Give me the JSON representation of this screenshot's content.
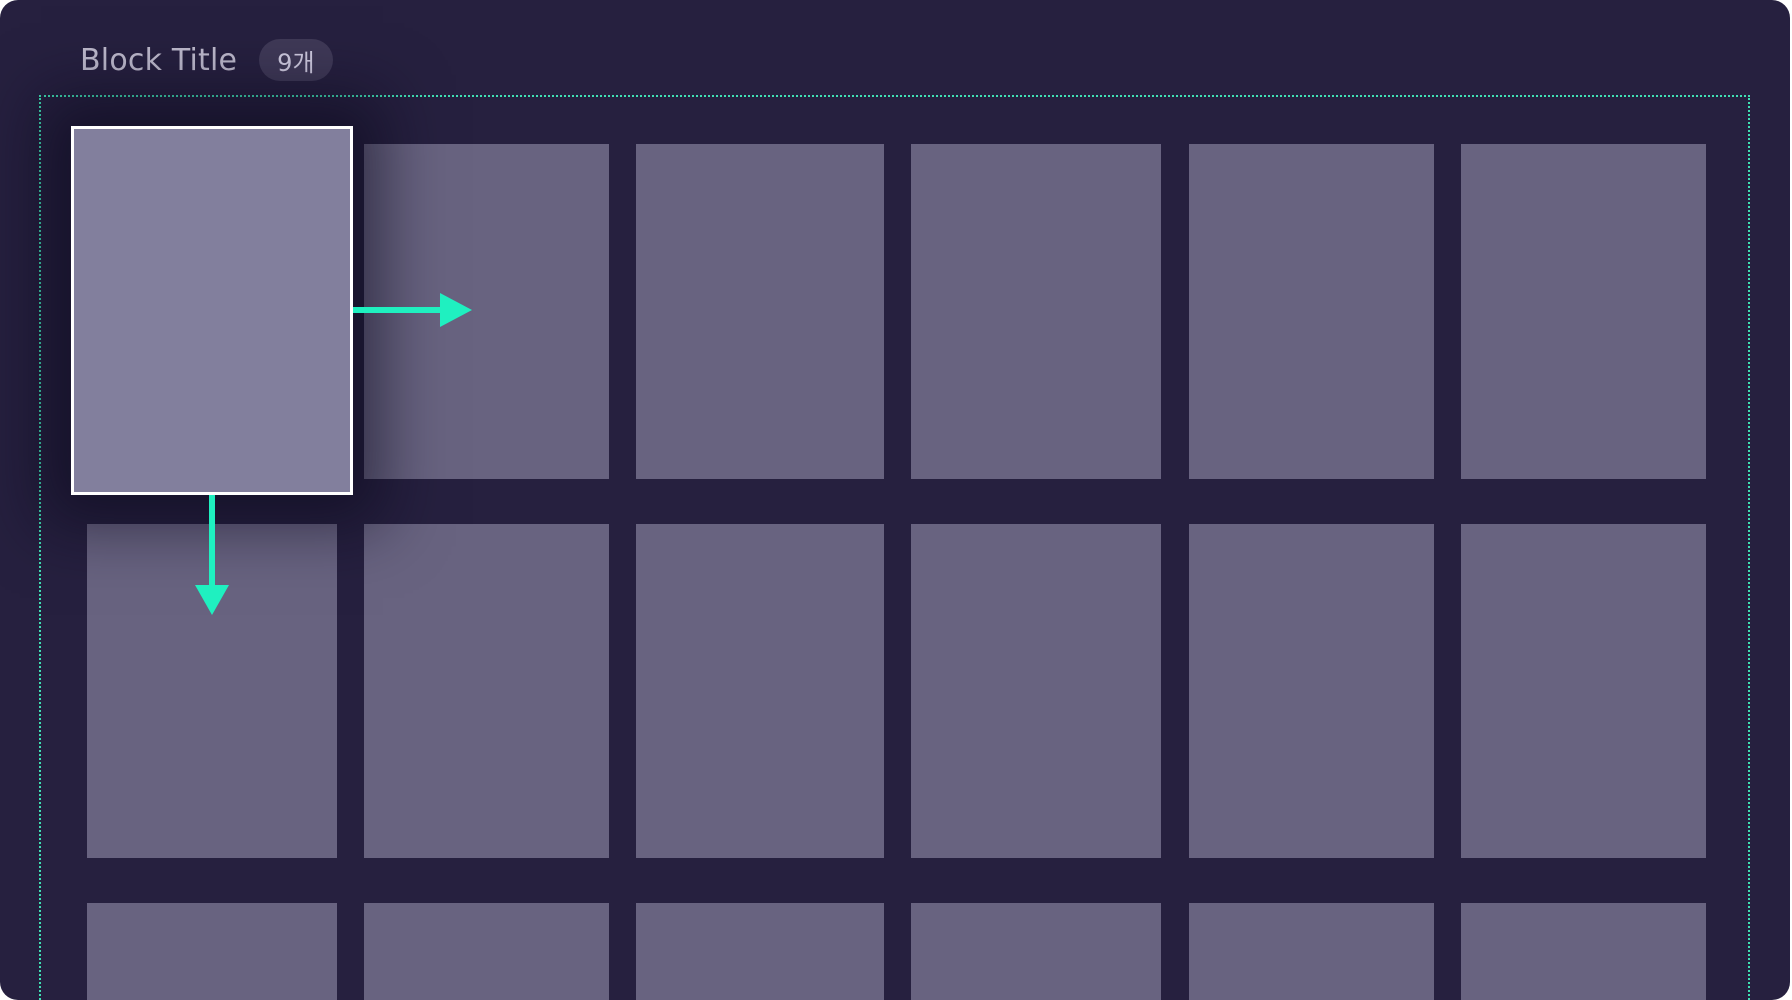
{
  "block": {
    "title": "Block Title",
    "count": "9개"
  },
  "grid": {
    "rows_visible": 3,
    "columns": 6,
    "focused": {
      "row": 1,
      "column": 1
    },
    "navigation": [
      "right",
      "down"
    ]
  },
  "colors": {
    "background": "#26203f",
    "tile": "#686380",
    "focused_tile": "#827f9d",
    "focus_border": "#ffffff",
    "accent": "#1ff0c0"
  }
}
